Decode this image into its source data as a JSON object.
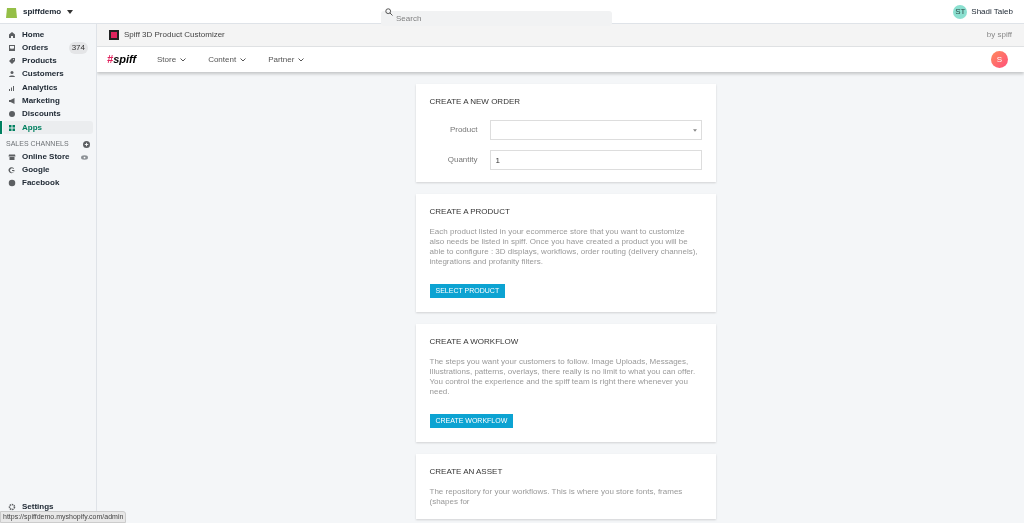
{
  "topbar": {
    "store": "spiffdemo",
    "search": {
      "placeholder": "Search"
    },
    "user": {
      "initials": "ST",
      "name": "Shadi Taleb"
    }
  },
  "sidebar": {
    "items": [
      {
        "label": "Home",
        "selected": false
      },
      {
        "label": "Orders",
        "selected": false,
        "badge": "374"
      },
      {
        "label": "Products",
        "selected": false
      },
      {
        "label": "Customers",
        "selected": false
      },
      {
        "label": "Analytics",
        "selected": false
      },
      {
        "label": "Marketing",
        "selected": false
      },
      {
        "label": "Discounts",
        "selected": false
      },
      {
        "label": "Apps",
        "selected": true
      }
    ],
    "section_title": "SALES CHANNELS",
    "channels": [
      {
        "label": "Online Store"
      },
      {
        "label": "Google"
      },
      {
        "label": "Facebook"
      }
    ],
    "settings": "Settings"
  },
  "app_header": {
    "title": "Spiff 3D Product Customizer",
    "by": "by spiff"
  },
  "app_nav": {
    "logo": "#spiff",
    "menus": [
      "Store",
      "Content",
      "Partner"
    ],
    "avatar": "S"
  },
  "order_card": {
    "title": "CREATE A NEW ORDER",
    "product_label": "Product",
    "quantity_label": "Quantity",
    "quantity": "1"
  },
  "cards": [
    {
      "title": "CREATE A PRODUCT",
      "text": "Each product listed in your ecommerce store that you want to customize also needs be listed in spiff. Once you have created a product you will be able to configure : 3D displays, workflows, order routing (delivery channels), integrations and profanity filters.",
      "button": "SELECT PRODUCT"
    },
    {
      "title": "CREATE A WORKFLOW",
      "text": "The steps you want your customers to follow. Image Uploads, Messages, Illustrations, patterns, overlays, there really is no limit to what you can offer. You control the experience and the spiff team is right there whenever you need.",
      "button": "CREATE WORKFLOW"
    },
    {
      "title": "CREATE AN ASSET",
      "text": "The repository for your workflows. This is where you store fonts, frames (shapes for"
    }
  ],
  "status_url": "https://spiffdemo.myshopify.com/admin"
}
